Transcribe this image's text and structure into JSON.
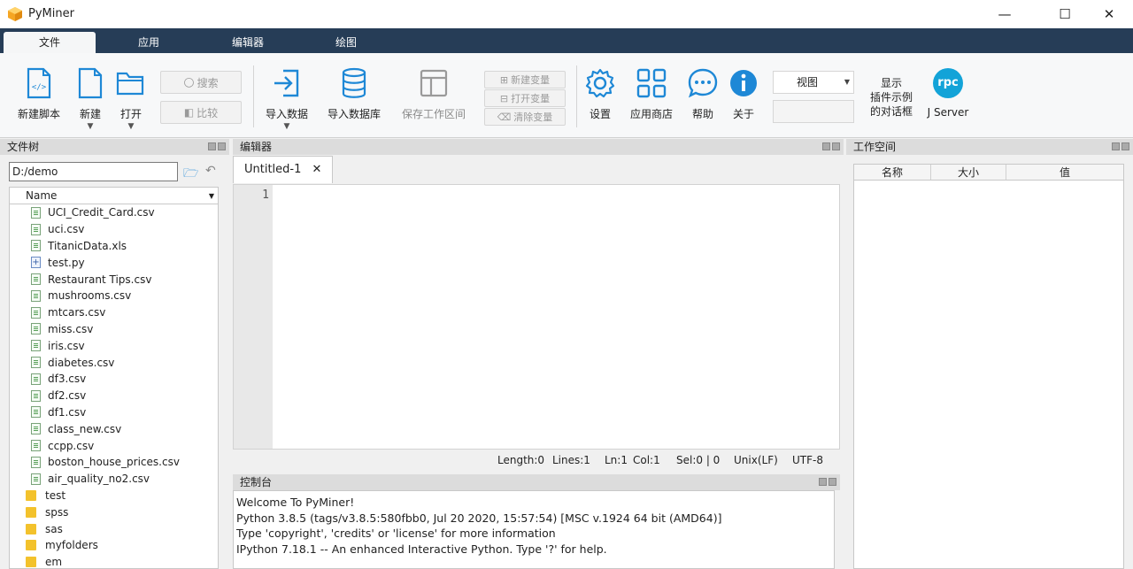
{
  "window": {
    "title": "PyMiner",
    "minimize_glyph": "—",
    "maximize_glyph": "☐",
    "close_glyph": "✕"
  },
  "ribbon_tabs": [
    {
      "label": "文件",
      "active": true
    },
    {
      "label": "应用",
      "active": false
    },
    {
      "label": "编辑器",
      "active": false
    },
    {
      "label": "绘图",
      "active": false
    }
  ],
  "ribbon": {
    "new_script": "新建脚本",
    "new": "新建",
    "open": "打开",
    "search": "搜索",
    "compare": "比较",
    "import_data": "导入数据",
    "import_db": "导入数据库",
    "save_workspace": "保存工作区间",
    "new_variable": "新建变量",
    "open_variable": "打开变量",
    "clear_variable": "清除变量",
    "settings": "设置",
    "app_store": "应用商店",
    "help": "帮助",
    "about": "关于",
    "view_select": "视图",
    "show_plugin_line1": "显示",
    "show_plugin_line2": "插件示例",
    "show_plugin_line3": "的对话框",
    "jserver": "J Server",
    "rpc_logo": "rpc"
  },
  "file_panel": {
    "title": "文件树",
    "path": "D:/demo",
    "column": "Name",
    "files": [
      {
        "name": "UCI_Credit_Card.csv",
        "kind": "csv"
      },
      {
        "name": "uci.csv",
        "kind": "csv"
      },
      {
        "name": "TitanicData.xls",
        "kind": "csv"
      },
      {
        "name": "test.py",
        "kind": "py"
      },
      {
        "name": "Restaurant Tips.csv",
        "kind": "csv"
      },
      {
        "name": "mushrooms.csv",
        "kind": "csv"
      },
      {
        "name": "mtcars.csv",
        "kind": "csv"
      },
      {
        "name": "miss.csv",
        "kind": "csv"
      },
      {
        "name": "iris.csv",
        "kind": "csv"
      },
      {
        "name": "diabetes.csv",
        "kind": "csv"
      },
      {
        "name": "df3.csv",
        "kind": "csv"
      },
      {
        "name": "df2.csv",
        "kind": "csv"
      },
      {
        "name": "df1.csv",
        "kind": "csv"
      },
      {
        "name": "class_new.csv",
        "kind": "csv"
      },
      {
        "name": "ccpp.csv",
        "kind": "csv"
      },
      {
        "name": "boston_house_prices.csv",
        "kind": "csv"
      },
      {
        "name": "air_quality_no2.csv",
        "kind": "csv"
      }
    ],
    "folders": [
      "test",
      "spss",
      "sas",
      "myfolders",
      "em"
    ]
  },
  "editor": {
    "title": "编辑器",
    "tab_label": "Untitled-1",
    "tab_close": "✕",
    "line_number": "1",
    "status": {
      "length": "Length:0",
      "lines": "Lines:1",
      "ln": "Ln:1",
      "col": "Col:1",
      "sel": "Sel:0 | 0",
      "eol": "Unix(LF)",
      "encoding": "UTF-8"
    }
  },
  "console": {
    "title": "控制台",
    "lines": [
      "Welcome To PyMiner!",
      "Python 3.8.5 (tags/v3.8.5:580fbb0, Jul 20 2020, 15:57:54) [MSC v.1924 64 bit (AMD64)]",
      "Type 'copyright', 'credits' or 'license' for more information",
      "IPython 7.18.1 -- An enhanced Interactive Python. Type '?' for help."
    ]
  },
  "workspace": {
    "title": "工作空间",
    "columns": [
      "名称",
      "大小",
      "值"
    ]
  },
  "colors": {
    "tabbar": "#263d57",
    "icon_blue": "#1e88d6",
    "folder": "#f3c22c"
  }
}
